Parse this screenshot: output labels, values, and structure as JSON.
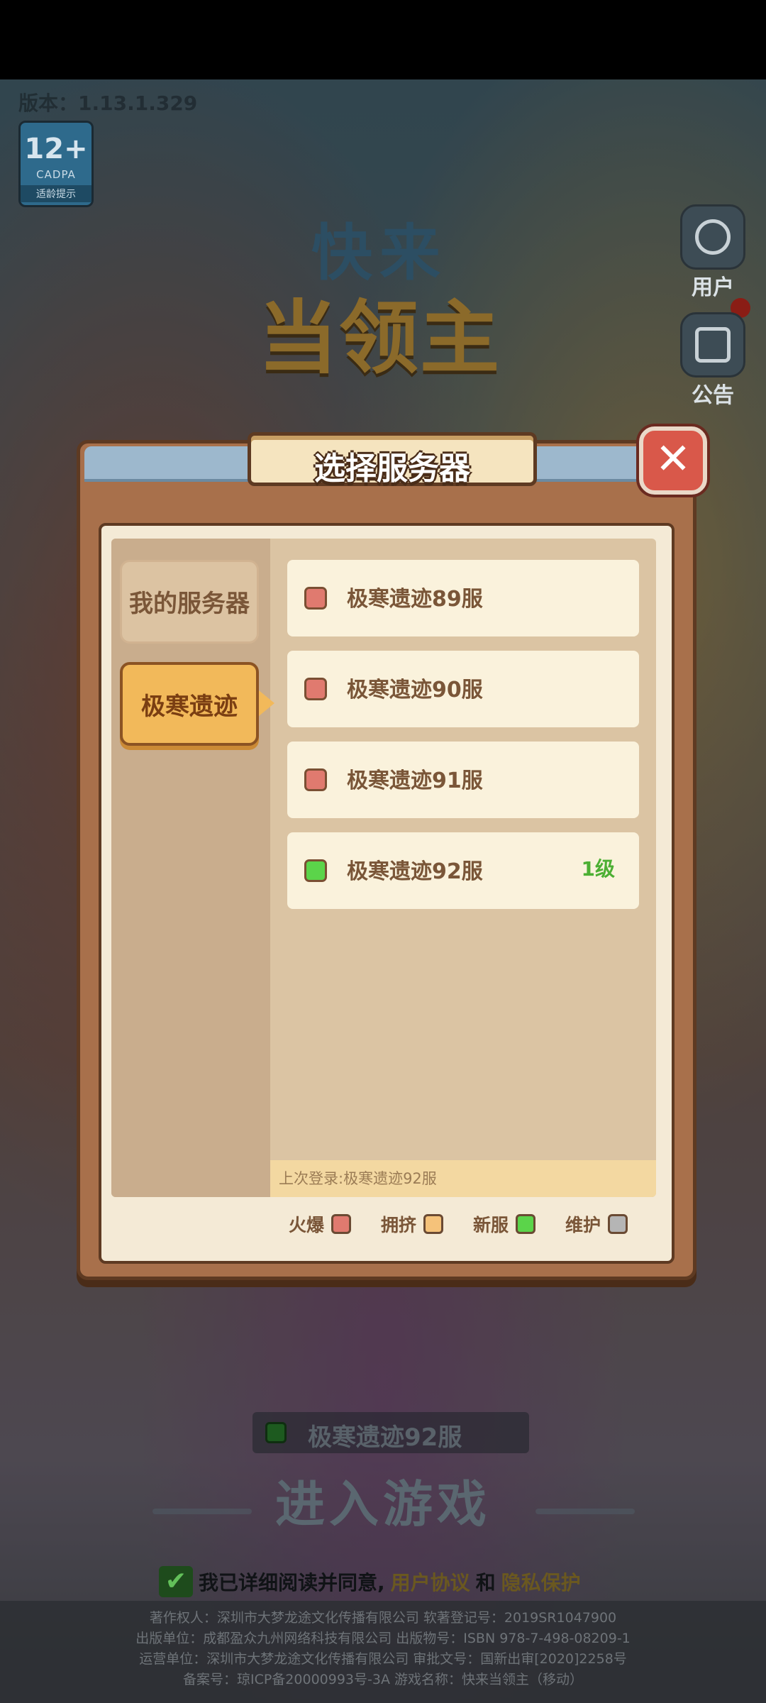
{
  "header": {
    "version_text": "版本：1.13.1.329"
  },
  "age_badge": {
    "rating": "12+",
    "org": "CADPA",
    "tip": "适龄提示"
  },
  "logo": {
    "line1": "快来",
    "line2": "当领主"
  },
  "side_buttons": {
    "user_label": "用户",
    "notice_label": "公告"
  },
  "dialog": {
    "title": "选择服务器",
    "close_symbol": "✕",
    "categories": [
      {
        "label": "我的服务器",
        "active": false
      },
      {
        "label": "极寒遗迹",
        "active": true
      }
    ],
    "servers": [
      {
        "name": "极寒遗迹89服",
        "status_color": "#e07a6f",
        "level": ""
      },
      {
        "name": "极寒遗迹90服",
        "status_color": "#e07a6f",
        "level": ""
      },
      {
        "name": "极寒遗迹91服",
        "status_color": "#e07a6f",
        "level": ""
      },
      {
        "name": "极寒遗迹92服",
        "status_color": "#5bd44a",
        "level": "1级"
      }
    ],
    "last_login": "上次登录:极寒遗迹92服",
    "legend": [
      {
        "label": "火爆",
        "color": "#e07a6f"
      },
      {
        "label": "拥挤",
        "color": "#f5c27a"
      },
      {
        "label": "新服",
        "color": "#5bd44a"
      },
      {
        "label": "维护",
        "color": "#b5b5b5"
      }
    ]
  },
  "bottom": {
    "selected_server": "极寒遗迹92服",
    "enter_label": "进入游戏",
    "agree_prefix": "我已详细阅读并同意,",
    "user_agreement": "用户协议",
    "and": "和",
    "privacy_policy": "隐私保护"
  },
  "footer": {
    "line1": "著作权人：深圳市大梦龙途文化传播有限公司 软著登记号：2019SR1047900",
    "line2": "出版单位：成都盈众九州网络科技有限公司 出版物号：ISBN 978-7-498-08209-1",
    "line3": "运营单位：深圳市大梦龙途文化传播有限公司 审批文号：国新出审[2020]2258号",
    "line4": "备案号：琼ICP备20000993号-3A 游戏名称：快来当领主（移动）"
  }
}
